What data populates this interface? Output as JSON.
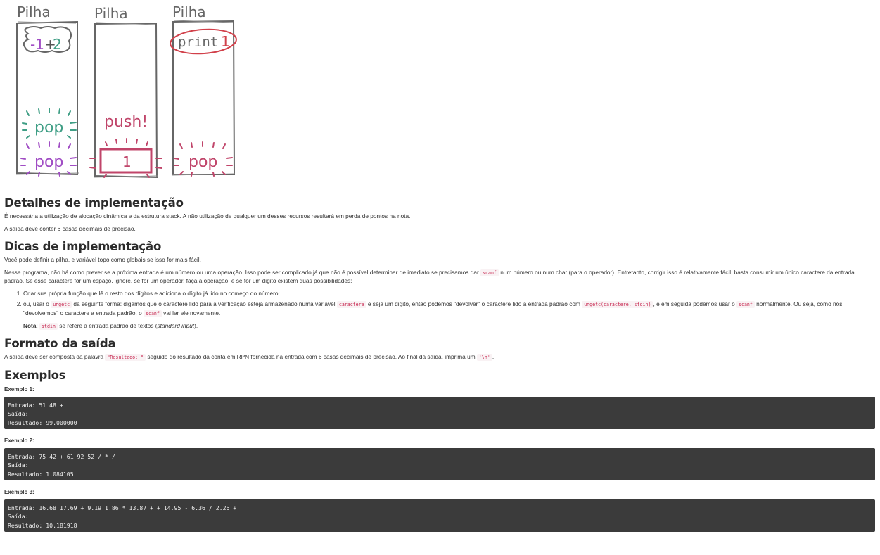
{
  "diagram": {
    "stack_label": "Pilha",
    "col1": {
      "top_a": "-1",
      "top_op": "+",
      "top_b": "2",
      "pop1": "pop",
      "pop2": "pop"
    },
    "col2": {
      "push": "push!",
      "value": "1"
    },
    "col3": {
      "print_word": "print",
      "print_value": "1",
      "pop": "pop"
    },
    "colors": {
      "purple": "#a04cc4",
      "teal": "#3f9e85",
      "crimson": "#c0456a",
      "red": "#d1404a",
      "ink": "#555555"
    }
  },
  "sections": {
    "detalhes": {
      "title": "Detalhes de implementação",
      "p1": "É necessária a utilização de alocação dinâmica e da estrutura stack. A não utilização de qualquer um desses recursos resultará em perda de pontos na nota.",
      "p2": "A saída deve conter 6 casas decimais de precisão."
    },
    "dicas": {
      "title": "Dicas de implementação",
      "p1": "Você pode definir a pilha, e variável topo como globais se isso for mais fácil.",
      "p2_a": "Nesse programa, não há como prever se a próxima entrada é um número ou uma operação. Isso pode ser complicado já que não é possível determinar de imediato se precisamos dar ",
      "p2_code": "scanf",
      "p2_b": " num número ou num char (para o operador). Entretanto, corrigir isso é relativamente fácil, basta consumir um único caractere da entrada padrão. Se esse caractere for um espaço, ignore, se for um operador, faça a operação, e se for um digito existem duas possibilidades:",
      "li1": "Criar sua própria função que lê o resto dos dígitos e adiciona o dígito já lido no começo do número;",
      "li2_a": "ou, usar o ",
      "li2_code1": "ungetc",
      "li2_b": " da seguinte forma: digamos que o caractere lido para a verificação esteja armazenado numa variável ",
      "li2_code2": "caractere",
      "li2_c": " e seja um digito, então podemos \"devolver\" o caractere lido a entrada padrão com ",
      "li2_code3": "ungetc(caractere, stdin)",
      "li2_d": ", e em seguida podemos usar o ",
      "li2_code4": "scanf",
      "li2_e": " normalmente. Ou seja, como nós \"devolvemos\" o caractere a entrada padrão, o ",
      "li2_code5": "scanf",
      "li2_f": " vai ler ele novamente.",
      "note_label": "Nota",
      "note_colon": ": ",
      "note_code": "stdin",
      "note_b": " se refere a entrada padrão de textos (",
      "note_em": "standard input",
      "note_c": ")."
    },
    "formato": {
      "title": "Formato da saída",
      "p_a": "A saída deve ser composta da palavra ",
      "p_code1": "\"Resultado: \"",
      "p_b": " seguido do resultado da conta em RPN fornecida na entrada com 6 casas decimais de precisão. Ao final da saída, imprima um ",
      "p_code2": "'\\n'",
      "p_c": "."
    },
    "exemplos": {
      "title": "Exemplos",
      "items": [
        {
          "label": "Exemplo 1:",
          "code": "Entrada: 51 48 +\nSaída:\nResultado: 99.000000"
        },
        {
          "label": "Exemplo 2:",
          "code": "Entrada: 75 42 + 61 92 52 / * /\nSaída:\nResultado: 1.084105"
        },
        {
          "label": "Exemplo 3:",
          "code": "Entrada: 16.68 17.69 + 9.19 1.86 * 13.87 + + 14.95 - 6.36 / 2.26 +\nSaída:\nResultado: 10.181918"
        }
      ]
    }
  }
}
